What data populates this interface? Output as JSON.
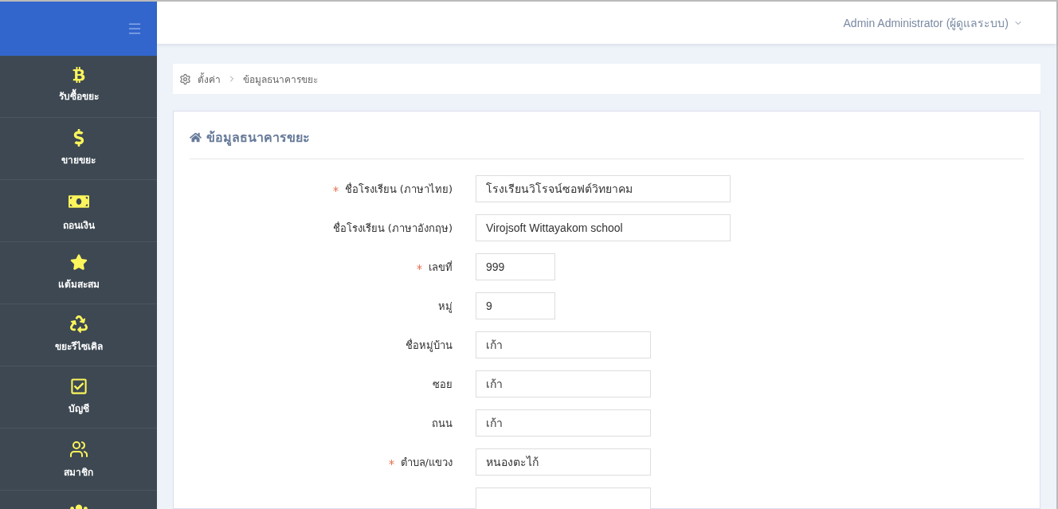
{
  "sidebar": {
    "items": [
      {
        "kind": "bitcoin",
        "label": "รับซื้อขยะ"
      },
      {
        "kind": "dollar",
        "label": "ขายขยะ"
      },
      {
        "kind": "money",
        "label": "ถอนเงิน"
      },
      {
        "kind": "star",
        "label": "แต้มสะสม"
      },
      {
        "kind": "recycle",
        "label": "ขยะรีไซเคิล"
      },
      {
        "kind": "check",
        "label": "บัญชี"
      },
      {
        "kind": "member",
        "label": "สมาชิก"
      },
      {
        "kind": "group"
      }
    ]
  },
  "header": {
    "user": "Admin Administrator (ผู้ดูแลระบบ)"
  },
  "breadcrumb": [
    "ตั้งค่า",
    "ข้อมูลธนาคารขยะ"
  ],
  "card": {
    "title": "ข้อมูลธนาคารขยะ",
    "fields": [
      {
        "label": "ชื่อโรงเรียน (ภาษาไทย)",
        "required": true,
        "kind": "wide",
        "value": "โรงเรียนวิโรจน์ซอฟต์วิทยาคม"
      },
      {
        "label": "ชื่อโรงเรียน (ภาษาอังกฤษ)",
        "required": false,
        "kind": "wide",
        "value": "Virojsoft Wittayakom school"
      },
      {
        "label": "เลขที่",
        "required": true,
        "kind": "short",
        "value": "999"
      },
      {
        "label": "หมู่",
        "required": false,
        "kind": "short",
        "value": "9"
      },
      {
        "label": "ชื่อหมู่บ้าน",
        "required": false,
        "kind": "medium",
        "value": "เก้า"
      },
      {
        "label": "ซอย",
        "required": false,
        "kind": "medium",
        "value": "เก้า"
      },
      {
        "label": "ถนน",
        "required": false,
        "kind": "medium",
        "value": "เก้า"
      },
      {
        "label": "ตำบล/แขวง",
        "required": true,
        "kind": "medium",
        "value": "หนองตะไก้"
      },
      {
        "required": false,
        "kind": "medium"
      }
    ]
  }
}
